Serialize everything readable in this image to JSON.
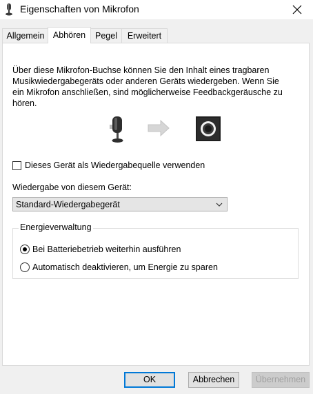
{
  "window": {
    "title": "Eigenschaften von Mikrofon",
    "icon": "microphone-icon",
    "close_icon": "close-icon"
  },
  "tabs": [
    {
      "label": "Allgemein",
      "active": false
    },
    {
      "label": "Abhören",
      "active": true
    },
    {
      "label": "Pegel",
      "active": false
    },
    {
      "label": "Erweitert",
      "active": false
    }
  ],
  "listen": {
    "description_lines": [
      "Über diese Mikrofon-Buchse können Sie den Inhalt eines tragbaren",
      "Musikwiedergabegeräts oder anderen Geräts wiedergeben. Wenn Sie",
      "ein Mikrofon anschließen, sind möglicherweise Feedbackgeräusche zu",
      "hören."
    ],
    "illustration_icons": [
      "microphone-icon",
      "arrow-right-icon",
      "speaker-icon"
    ],
    "listen_checkbox_label": "Dieses Gerät als Wiedergabequelle verwenden",
    "listen_checked": false,
    "playback_label": "Wiedergabe von diesem Gerät:",
    "playback_device": "Standard-Wiedergabegerät"
  },
  "power": {
    "legend": "Energieverwaltung",
    "options": [
      {
        "label": "Bei Batteriebetrieb weiterhin ausführen",
        "selected": true
      },
      {
        "label": "Automatisch deaktivieren, um Energie zu sparen",
        "selected": false
      }
    ]
  },
  "buttons": {
    "ok": "OK",
    "cancel": "Abbrechen",
    "apply": "Übernehmen",
    "apply_enabled": false
  },
  "colors": {
    "accent": "#0078d7",
    "window_bg": "#f0f0f0",
    "panel_bg": "#ffffff"
  }
}
